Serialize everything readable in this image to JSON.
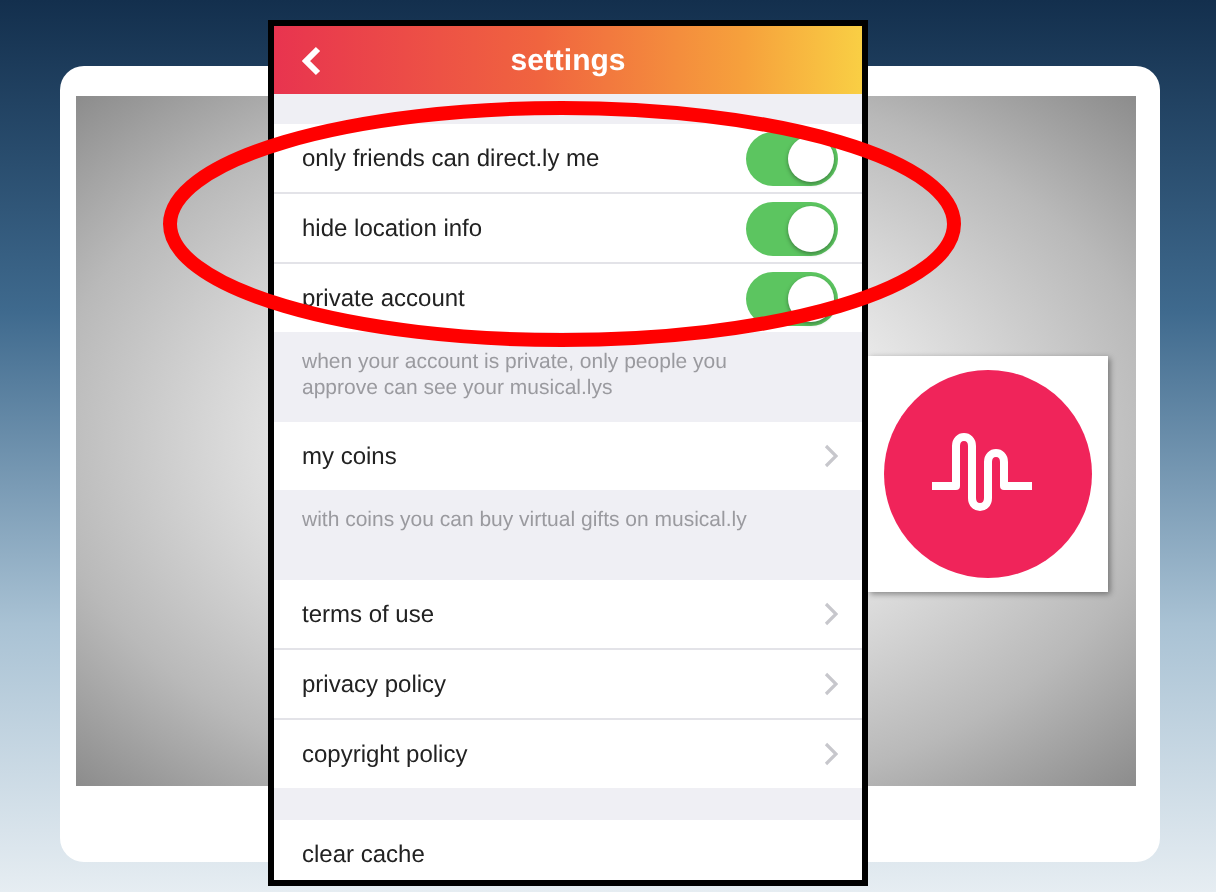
{
  "header": {
    "title": "settings"
  },
  "groups": [
    {
      "items": [
        {
          "kind": "toggle",
          "label": "only friends can direct.ly me",
          "on": true
        },
        {
          "kind": "toggle",
          "label": "hide location info",
          "on": true
        },
        {
          "kind": "toggle",
          "label": "private account",
          "on": true
        }
      ],
      "note": "when your account is private, only people you approve can see your musical.lys"
    },
    {
      "items": [
        {
          "kind": "link",
          "label": "my coins"
        }
      ],
      "note": "with coins you can buy virtual gifts on musical.ly"
    },
    {
      "items": [
        {
          "kind": "link",
          "label": "terms of use"
        },
        {
          "kind": "link",
          "label": "privacy policy"
        },
        {
          "kind": "link",
          "label": "copyright policy"
        }
      ]
    },
    {
      "items": [
        {
          "kind": "plain",
          "label": "clear cache"
        }
      ]
    }
  ]
}
